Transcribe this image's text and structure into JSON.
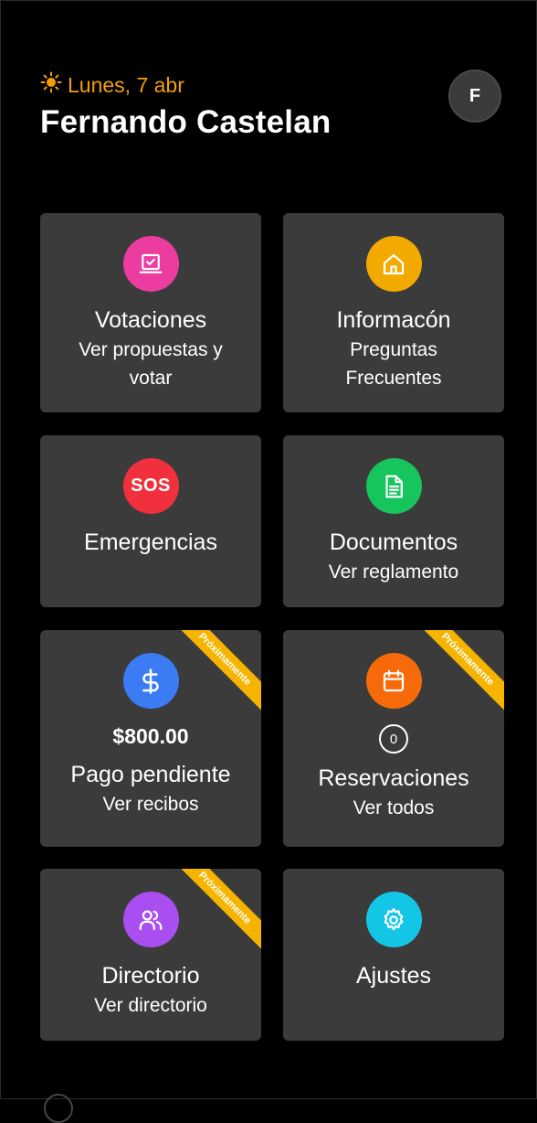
{
  "header": {
    "date_icon": "sun-icon",
    "date": "Lunes, 7 abr",
    "user_name": "Fernando Castelan",
    "avatar_initial": "F"
  },
  "colors": {
    "accent": "#f59e0b",
    "card_bg": "#3b3b3b",
    "ribbon": "#f5b400"
  },
  "cards": {
    "votaciones": {
      "icon": "ballot-box-icon",
      "color": "#ec3c9f",
      "title": "Votaciones",
      "sub": "Ver propuestas y votar"
    },
    "informacion": {
      "icon": "home-icon",
      "color": "#f2a900",
      "title": "Informacón",
      "sub": "Preguntas Frecuentes"
    },
    "emergencias": {
      "icon": "sos-icon",
      "icon_text": "SOS",
      "color": "#f0313d",
      "title": "Emergencias"
    },
    "documentos": {
      "icon": "document-icon",
      "color": "#16c55c",
      "title": "Documentos",
      "sub": "Ver reglamento"
    },
    "pago": {
      "icon": "dollar-icon",
      "color": "#3b7cf5",
      "ribbon": "Próximamente",
      "amount": "$800.00",
      "title": "Pago pendiente",
      "sub": "Ver recibos"
    },
    "reservaciones": {
      "icon": "calendar-icon",
      "color": "#f76a0a",
      "ribbon": "Próximamente",
      "count": "0",
      "title": "Reservaciones",
      "sub": "Ver todos"
    },
    "directorio": {
      "icon": "users-icon",
      "color": "#a94ef0",
      "ribbon": "Próximamente",
      "title": "Directorio",
      "sub": "Ver directorio"
    },
    "ajustes": {
      "icon": "gear-icon",
      "color": "#14c6e6",
      "title": "Ajustes"
    }
  }
}
